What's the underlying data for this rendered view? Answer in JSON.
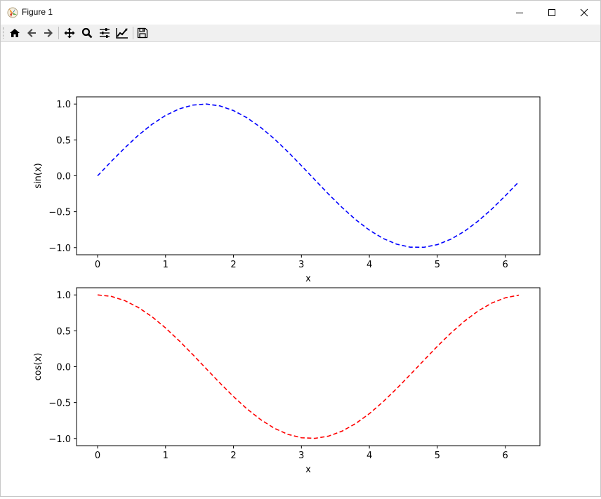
{
  "window": {
    "title": "Figure 1",
    "icons": [
      "matplotlib-icon",
      "minimize-icon",
      "maximize-icon",
      "close-icon"
    ]
  },
  "toolbar": {
    "buttons": [
      "home-icon",
      "back-icon",
      "forward-icon",
      "pan-icon",
      "zoom-icon",
      "subplots-icon",
      "customize-icon",
      "save-icon"
    ]
  },
  "chart_data": [
    {
      "type": "line",
      "xlabel": "x",
      "ylabel": "sin(x)",
      "xlim": [
        -0.31,
        6.51
      ],
      "ylim": [
        -1.1,
        1.1
      ],
      "xticks": [
        "0",
        "1",
        "2",
        "3",
        "4",
        "5",
        "6"
      ],
      "yticks": [
        "1.0",
        "0.5",
        "0.0",
        "−0.5",
        "−1.0"
      ],
      "grid": false,
      "series": [
        {
          "color": "#0000ff",
          "linestyle": "dashed",
          "x": [
            0.0,
            0.2,
            0.4,
            0.6,
            0.8,
            1.0,
            1.2,
            1.4,
            1.6,
            1.8,
            2.0,
            2.2,
            2.4,
            2.6,
            2.8,
            3.0,
            3.2,
            3.4,
            3.6,
            3.8,
            4.0,
            4.2,
            4.4,
            4.6,
            4.8,
            5.0,
            5.2,
            5.4,
            5.6,
            5.8,
            6.0,
            6.2
          ],
          "y": [
            0.0,
            0.199,
            0.389,
            0.565,
            0.717,
            0.841,
            0.932,
            0.985,
            1.0,
            0.974,
            0.909,
            0.808,
            0.675,
            0.516,
            0.335,
            0.141,
            -0.058,
            -0.256,
            -0.443,
            -0.612,
            -0.757,
            -0.872,
            -0.952,
            -0.994,
            -0.996,
            -0.959,
            -0.883,
            -0.773,
            -0.631,
            -0.465,
            -0.279,
            -0.083
          ]
        }
      ]
    },
    {
      "type": "line",
      "xlabel": "x",
      "ylabel": "cos(x)",
      "xlim": [
        -0.31,
        6.51
      ],
      "ylim": [
        -1.1,
        1.1
      ],
      "xticks": [
        "0",
        "1",
        "2",
        "3",
        "4",
        "5",
        "6"
      ],
      "yticks": [
        "1.0",
        "0.5",
        "0.0",
        "−0.5",
        "−1.0"
      ],
      "grid": false,
      "series": [
        {
          "color": "#ff0000",
          "linestyle": "dashed",
          "x": [
            0.0,
            0.2,
            0.4,
            0.6,
            0.8,
            1.0,
            1.2,
            1.4,
            1.6,
            1.8,
            2.0,
            2.2,
            2.4,
            2.6,
            2.8,
            3.0,
            3.2,
            3.4,
            3.6,
            3.8,
            4.0,
            4.2,
            4.4,
            4.6,
            4.8,
            5.0,
            5.2,
            5.4,
            5.6,
            5.8,
            6.0,
            6.2
          ],
          "y": [
            1.0,
            0.98,
            0.921,
            0.825,
            0.697,
            0.54,
            0.362,
            0.17,
            -0.029,
            -0.227,
            -0.416,
            -0.589,
            -0.737,
            -0.857,
            -0.942,
            -0.99,
            -0.998,
            -0.967,
            -0.897,
            -0.791,
            -0.654,
            -0.49,
            -0.307,
            -0.112,
            0.087,
            0.284,
            0.469,
            0.635,
            0.776,
            0.886,
            0.96,
            0.997
          ]
        }
      ]
    }
  ]
}
